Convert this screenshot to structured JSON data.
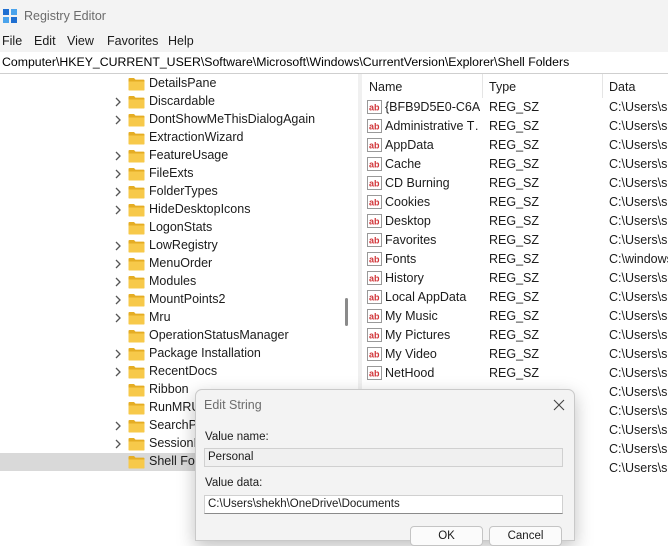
{
  "window": {
    "title": "Registry Editor"
  },
  "menu": [
    "File",
    "Edit",
    "View",
    "Favorites",
    "Help"
  ],
  "address": "Computer\\HKEY_CURRENT_USER\\Software\\Microsoft\\Windows\\CurrentVersion\\Explorer\\Shell Folders",
  "tree": [
    {
      "label": "DetailsPane",
      "expandable": false
    },
    {
      "label": "Discardable",
      "expandable": true
    },
    {
      "label": "DontShowMeThisDialogAgain",
      "expandable": true
    },
    {
      "label": "ExtractionWizard",
      "expandable": false
    },
    {
      "label": "FeatureUsage",
      "expandable": true
    },
    {
      "label": "FileExts",
      "expandable": true
    },
    {
      "label": "FolderTypes",
      "expandable": true
    },
    {
      "label": "HideDesktopIcons",
      "expandable": true
    },
    {
      "label": "LogonStats",
      "expandable": false
    },
    {
      "label": "LowRegistry",
      "expandable": true
    },
    {
      "label": "MenuOrder",
      "expandable": true
    },
    {
      "label": "Modules",
      "expandable": true
    },
    {
      "label": "MountPoints2",
      "expandable": true
    },
    {
      "label": "Mru",
      "expandable": true
    },
    {
      "label": "OperationStatusManager",
      "expandable": false
    },
    {
      "label": "Package Installation",
      "expandable": true
    },
    {
      "label": "RecentDocs",
      "expandable": true
    },
    {
      "label": "Ribbon",
      "expandable": false
    },
    {
      "label": "RunMRU",
      "expandable": false
    },
    {
      "label": "SearchPl",
      "expandable": true
    },
    {
      "label": "SessionIn",
      "expandable": true
    },
    {
      "label": "Shell Fold",
      "expandable": false,
      "selected": true
    }
  ],
  "list": {
    "columns": [
      "Name",
      "Type",
      "Data"
    ],
    "rows": [
      {
        "name": "{BFB9D5E0-C6A…",
        "type": "REG_SZ",
        "data": "C:\\Users\\she"
      },
      {
        "name": "Administrative T…",
        "type": "REG_SZ",
        "data": "C:\\Users\\she"
      },
      {
        "name": "AppData",
        "type": "REG_SZ",
        "data": "C:\\Users\\she"
      },
      {
        "name": "Cache",
        "type": "REG_SZ",
        "data": "C:\\Users\\she"
      },
      {
        "name": "CD Burning",
        "type": "REG_SZ",
        "data": "C:\\Users\\she"
      },
      {
        "name": "Cookies",
        "type": "REG_SZ",
        "data": "C:\\Users\\she"
      },
      {
        "name": "Desktop",
        "type": "REG_SZ",
        "data": "C:\\Users\\she"
      },
      {
        "name": "Favorites",
        "type": "REG_SZ",
        "data": "C:\\Users\\she"
      },
      {
        "name": "Fonts",
        "type": "REG_SZ",
        "data": "C:\\windows"
      },
      {
        "name": "History",
        "type": "REG_SZ",
        "data": "C:\\Users\\she"
      },
      {
        "name": "Local AppData",
        "type": "REG_SZ",
        "data": "C:\\Users\\she"
      },
      {
        "name": "My Music",
        "type": "REG_SZ",
        "data": "C:\\Users\\she"
      },
      {
        "name": "My Pictures",
        "type": "REG_SZ",
        "data": "C:\\Users\\she"
      },
      {
        "name": "My Video",
        "type": "REG_SZ",
        "data": "C:\\Users\\she"
      },
      {
        "name": "NetHood",
        "type": "REG_SZ",
        "data": "C:\\Users\\she"
      },
      {
        "name": "",
        "type": "",
        "data": "C:\\Users\\she"
      },
      {
        "name": "",
        "type": "",
        "data": "C:\\Users\\she"
      },
      {
        "name": "",
        "type": "",
        "data": "C:\\Users\\she"
      },
      {
        "name": "",
        "type": "",
        "data": "C:\\Users\\she"
      },
      {
        "name": "",
        "type": "",
        "data": "C:\\Users\\she"
      }
    ]
  },
  "dialog": {
    "title": "Edit String",
    "value_name_label": "Value name:",
    "value_name": "Personal",
    "value_data_label": "Value data:",
    "value_data": "C:\\Users\\shekh\\OneDrive\\Documents",
    "ok_label": "OK",
    "cancel_label": "Cancel"
  },
  "colors": {
    "folder": "#f7c94a",
    "folder_dark": "#e5ad24",
    "reg_icon": "#d13438",
    "accent": "#0078d4"
  }
}
